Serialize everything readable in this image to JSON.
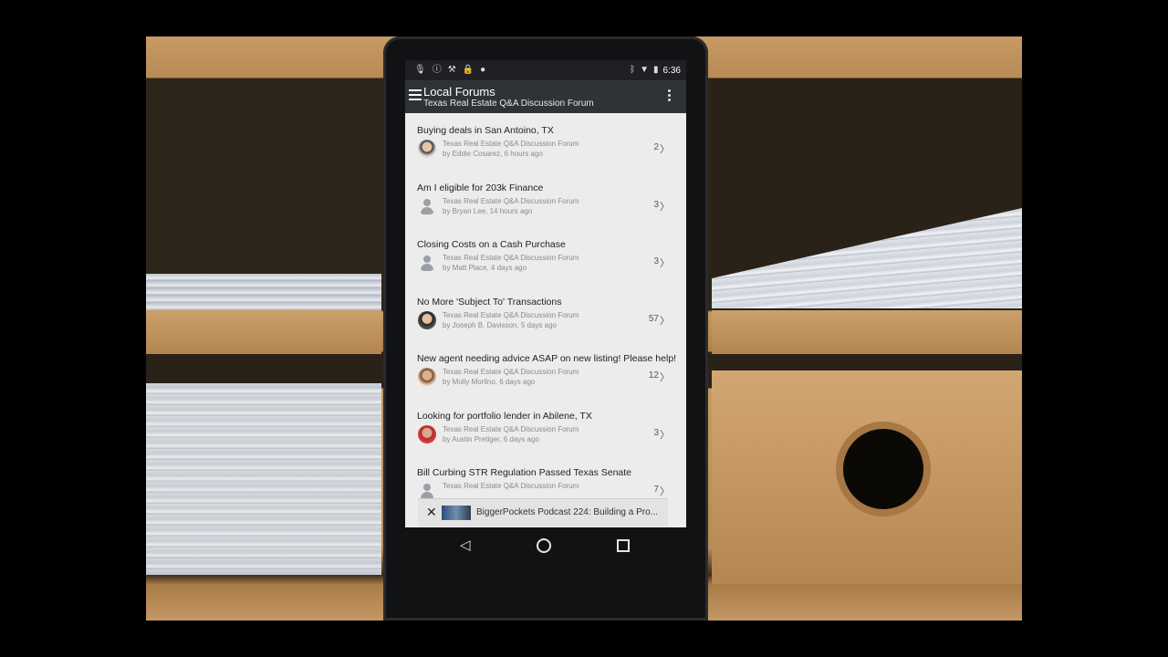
{
  "statusbar": {
    "left_icons": [
      "mic-icon",
      "info-icon",
      "tools-icon",
      "lock-icon",
      "android-icon"
    ],
    "right_icons": [
      "bluetooth-icon",
      "wifi-icon",
      "battery-icon"
    ],
    "time": "6:36"
  },
  "appbar": {
    "title": "Local Forums",
    "subtitle": "Texas Real Estate Q&A Discussion Forum"
  },
  "threads": [
    {
      "title": "Buying deals in San Antoino, TX",
      "forum": "Texas Real Estate Q&A Discussion Forum",
      "byline": "by Eddie Cosarez, 6 hours ago",
      "count": "2",
      "avatar": "photo1"
    },
    {
      "title": "Am I eligible for 203k Finance",
      "forum": "Texas Real Estate Q&A Discussion Forum",
      "byline": "by Bryan Lee, 14 hours ago",
      "count": "3",
      "avatar": "silhouette"
    },
    {
      "title": "Closing Costs on a Cash Purchase",
      "forum": "Texas Real Estate Q&A Discussion Forum",
      "byline": "by Matt Place, 4 days ago",
      "count": "3",
      "avatar": "silhouette"
    },
    {
      "title": "No More 'Subject To' Transactions",
      "forum": "Texas Real Estate Q&A Discussion Forum",
      "byline": "by Joseph B. Davisson, 5 days ago",
      "count": "57",
      "avatar": "photo2"
    },
    {
      "title": "New agent needing advice ASAP on new listing!  Please help!",
      "forum": "Texas Real Estate Q&A Discussion Forum",
      "byline": "by Molly Morlino, 6 days ago",
      "count": "12",
      "avatar": "photo3"
    },
    {
      "title": "Looking for portfolio lender in Abilene, TX",
      "forum": "Texas Real Estate Q&A Discussion Forum",
      "byline": "by Austin Pretiger, 6 days ago",
      "count": "3",
      "avatar": "photo4"
    },
    {
      "title": "Bill Curbing STR Regulation Passed Texas Senate",
      "forum": "Texas Real Estate Q&A Discussion Forum",
      "byline": "",
      "count": "7",
      "avatar": "silhouette"
    }
  ],
  "mini_player": {
    "close": "✕",
    "title": "BiggerPockets Podcast 224: Building a Pro..."
  },
  "navbar": {
    "back": "◁"
  }
}
